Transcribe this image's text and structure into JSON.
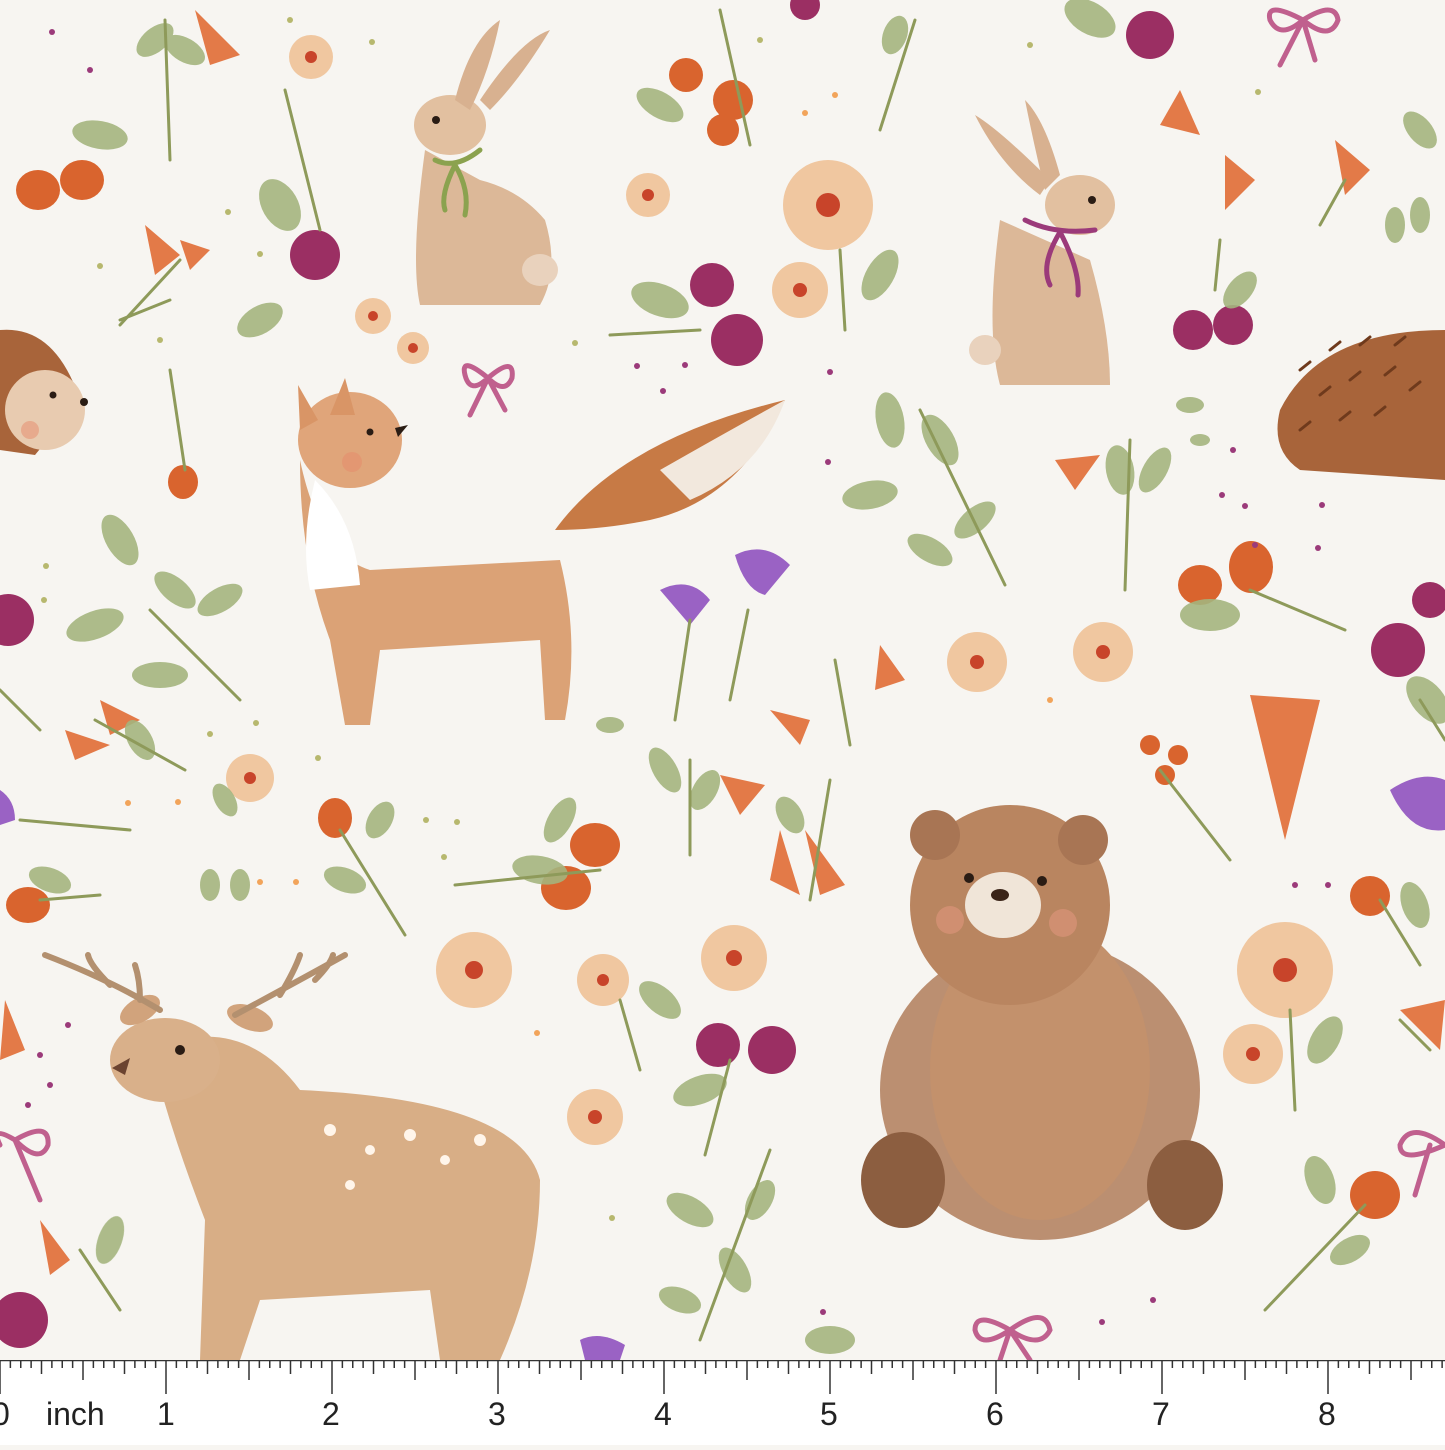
{
  "ruler": {
    "unit_label": "inch",
    "numbers": [
      "0",
      "1",
      "2",
      "3",
      "4",
      "5",
      "6",
      "7",
      "8"
    ]
  },
  "palette": {
    "background": "#f7f5f1",
    "fur_light": "#d9a67a",
    "fur_dark": "#a8764f",
    "leaf": "#9fb27a",
    "berry": "#9b2f63",
    "rosehip": "#d9642e",
    "bow": "#c0608e",
    "bluebell": "#9a62c4",
    "blossom": "#f0c7a0"
  },
  "motifs": [
    "bear",
    "deer",
    "fox",
    "rabbit",
    "rabbit",
    "hedgehog",
    "hedgehog"
  ]
}
